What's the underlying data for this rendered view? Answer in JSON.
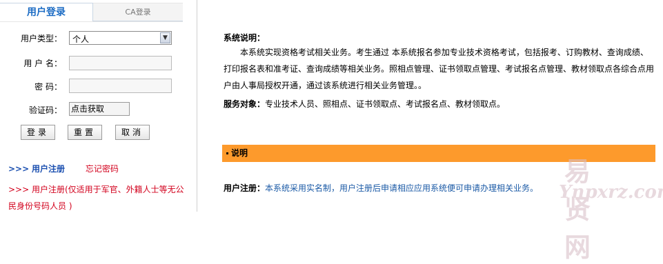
{
  "tabs": {
    "user_login": "用户登录",
    "ca_login": "CA登录"
  },
  "form": {
    "user_type_label": "用户类型：",
    "user_type_value": "个人",
    "username_label": "用 户 名：",
    "password_label": "密 码：",
    "captcha_label": "验证码：",
    "captcha_value": "点击获取",
    "login_button": "登录",
    "reset_button": "重置",
    "cancel_button": "取消"
  },
  "links": {
    "arrows": ">>>",
    "register": "用户注册",
    "forgot_password": "忘记密码",
    "register_special": "用户注册(仅适用于军官、外籍人士等无公民身份号码人员 )"
  },
  "content": {
    "title": "系统说明：",
    "paragraph": "本系统实现资格考试相关业务。考生通过 本系统报名参加专业技术资格考试，包括报考、订购教材、查询成绩、打印报名表和准考证、查询成绩等相关业务。照相点管理、证书领取点管理、考试报名点管理、教材领取点各综合点用户由人事局授权开通，通过该系统进行相关业务管理。。",
    "service_label": "服务对象：",
    "service_text": "专业技术人员、照相点、证书领取点、考试报名点、教材领取点。",
    "section_title": "说明",
    "reg_label": "用户注册：",
    "reg_text": "本系统采用实名制，用户注册后申请相应应用系统便可申请办理相关业务。"
  },
  "watermark": {
    "cn": "易贤网",
    "url": "Ynpxrz.com"
  },
  "colors": {
    "accent_blue": "#1c6cc4",
    "orange_bar": "#fd9a2c",
    "link_red": "#d2001c"
  }
}
